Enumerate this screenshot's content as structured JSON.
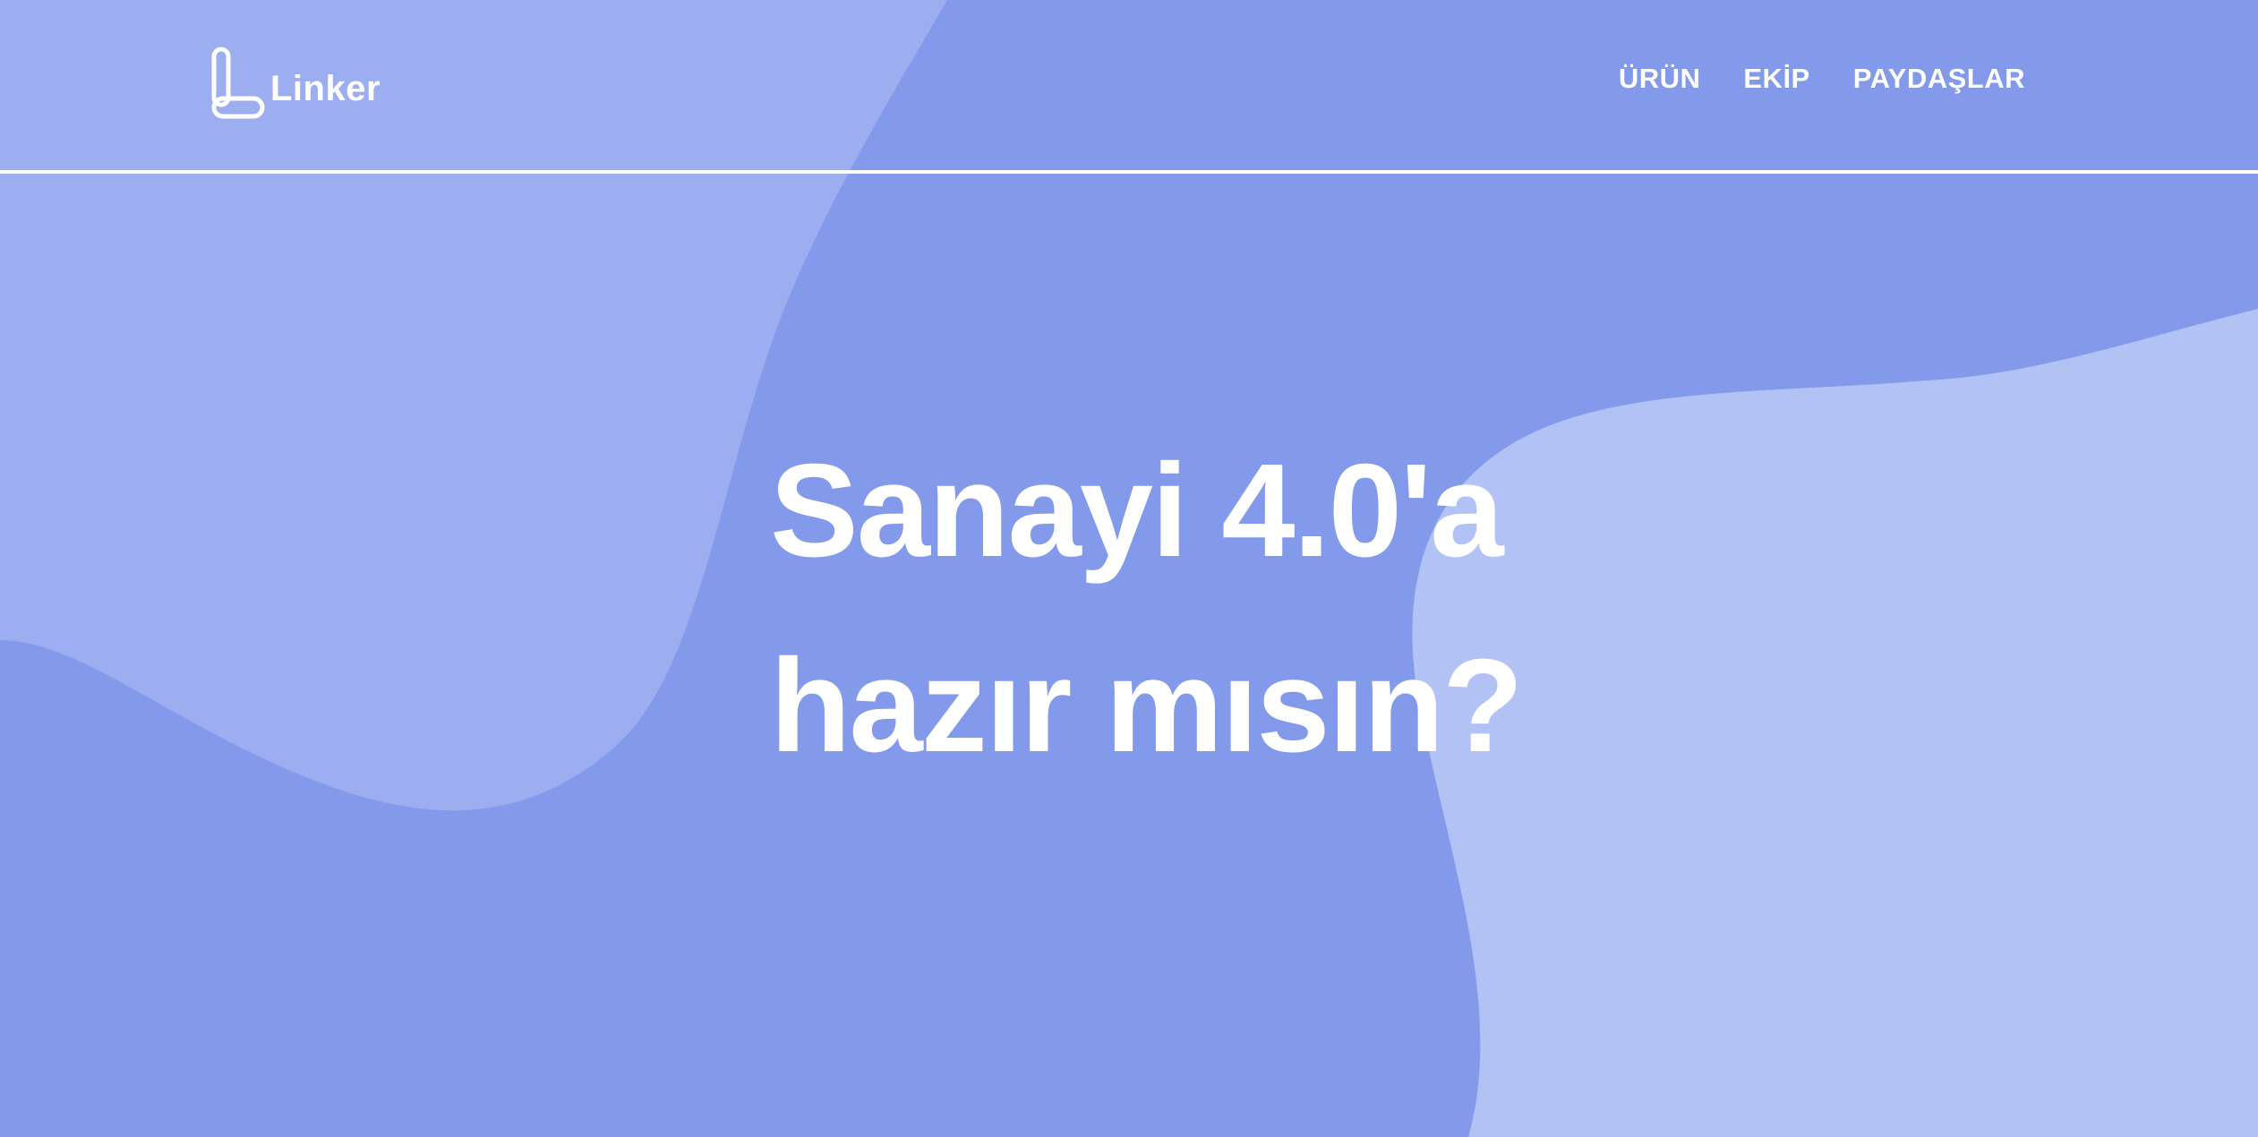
{
  "colors": {
    "background": "#8399ea",
    "shape_left": "#9daef0",
    "shape_right": "#b3c2f4",
    "text": "#ffffff"
  },
  "brand": {
    "name": "Linker",
    "icon": "linker-logo-icon"
  },
  "nav": {
    "items": [
      {
        "label": "ÜRÜN"
      },
      {
        "label": "EKİP"
      },
      {
        "label": "PAYDAŞLAR"
      }
    ]
  },
  "hero": {
    "line1": "Sanayi 4.0'a",
    "line2": "hazır mısın?"
  }
}
